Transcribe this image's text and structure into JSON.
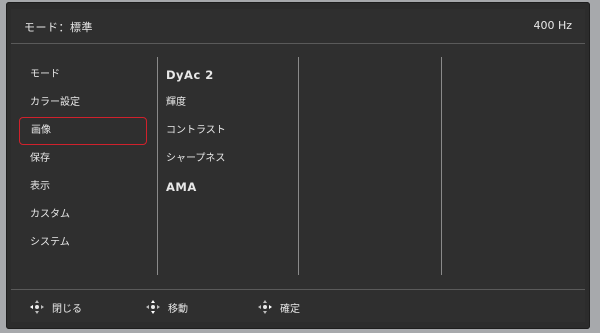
{
  "header": {
    "mode_title": "モード：標準",
    "refresh_rate": "400 Hz"
  },
  "menu": {
    "items": [
      {
        "label": "モード",
        "selected": false
      },
      {
        "label": "カラー設定",
        "selected": false
      },
      {
        "label": "画像",
        "selected": true
      },
      {
        "label": "保存",
        "selected": false
      },
      {
        "label": "表示",
        "selected": false
      },
      {
        "label": "カスタム",
        "selected": false
      },
      {
        "label": "システム",
        "selected": false
      }
    ]
  },
  "submenu": {
    "items": [
      {
        "label": "DyAc 2"
      },
      {
        "label": "輝度"
      },
      {
        "label": "コントラスト"
      },
      {
        "label": "シャープネス"
      },
      {
        "label": "AMA"
      }
    ]
  },
  "footer": {
    "close_label": "閉じる",
    "move_label": "移動",
    "confirm_label": "確定",
    "close_icon": "dpad-icon",
    "move_icon": "dpad-updown-icon",
    "confirm_icon": "dpad-press-icon"
  },
  "colors": {
    "background": "#2f2f2f",
    "text": "#e8e8e8",
    "selection_border": "#d0212c",
    "divider": "#8a8a8a"
  }
}
